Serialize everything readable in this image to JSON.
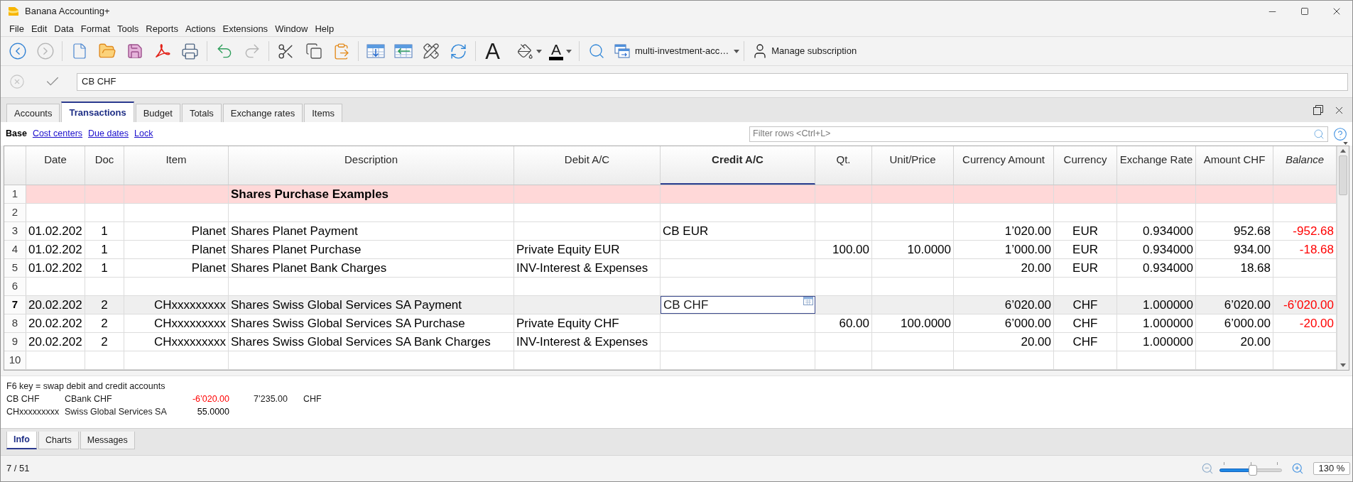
{
  "window": {
    "title": "Banana Accounting+"
  },
  "menu": [
    "File",
    "Edit",
    "Data",
    "Format",
    "Tools",
    "Reports",
    "Actions",
    "Extensions",
    "Window",
    "Help"
  ],
  "toolbar": {
    "back_disabled": false,
    "forward_disabled": true,
    "undo_disabled": false,
    "redo_disabled": true,
    "font_glyph": "A",
    "text_color_glyph": "A",
    "file_selector": "multi-investment-acc…",
    "subscription": "Manage subscription"
  },
  "formula_bar": {
    "value": "CB CHF"
  },
  "tabs": [
    {
      "label": "Accounts",
      "selected": false
    },
    {
      "label": "Transactions",
      "selected": true
    },
    {
      "label": "Budget",
      "selected": false
    },
    {
      "label": "Totals",
      "selected": false
    },
    {
      "label": "Exchange rates",
      "selected": false
    },
    {
      "label": "Items",
      "selected": false
    }
  ],
  "views": [
    {
      "label": "Base",
      "selected": true
    },
    {
      "label": "Cost centers",
      "selected": false
    },
    {
      "label": "Due dates",
      "selected": false
    },
    {
      "label": "Lock",
      "selected": false
    }
  ],
  "filter": {
    "placeholder": "Filter rows <Ctrl+L>"
  },
  "table": {
    "columns": [
      {
        "label": "Date",
        "selected": false,
        "protected": false
      },
      {
        "label": "Doc",
        "selected": false,
        "protected": false
      },
      {
        "label": "Item",
        "selected": false,
        "protected": false
      },
      {
        "label": "Description",
        "selected": false,
        "protected": false
      },
      {
        "label": "Debit A/C",
        "selected": false,
        "protected": false
      },
      {
        "label": "Credit A/C",
        "selected": true,
        "protected": false
      },
      {
        "label": "Qt.",
        "selected": false,
        "protected": false
      },
      {
        "label": "Unit/Price",
        "selected": false,
        "protected": false
      },
      {
        "label": "Currency Amount",
        "selected": false,
        "protected": false
      },
      {
        "label": "Currency",
        "selected": false,
        "protected": false
      },
      {
        "label": "Exchange Rate",
        "selected": false,
        "protected": false
      },
      {
        "label": "Amount CHF",
        "selected": false,
        "protected": false
      },
      {
        "label": "Balance",
        "selected": false,
        "protected": true
      }
    ],
    "rows": [
      {
        "number": "1",
        "kind": "title",
        "selected": false,
        "description": "Shares Purchase Examples"
      },
      {
        "number": "2",
        "kind": "entry",
        "selected": false
      },
      {
        "number": "3",
        "kind": "entry",
        "selected": false,
        "date": "01.02.202",
        "doc": "1",
        "item": "Planet",
        "description": "Shares Planet Payment",
        "credit_ac": "CB EUR",
        "currency_amount": "1’020.00",
        "currency": "EUR",
        "exchange_rate": "0.934000",
        "amount_chf": "952.68",
        "balance": "-952.68",
        "balance_negative": true
      },
      {
        "number": "4",
        "kind": "entry",
        "selected": false,
        "date": "01.02.202",
        "doc": "1",
        "item": "Planet",
        "description": "Shares Planet Purchase",
        "debit_ac": "Private Equity EUR",
        "qt": "100.00",
        "unit_price": "10.0000",
        "currency_amount": "1’000.00",
        "currency": "EUR",
        "exchange_rate": "0.934000",
        "amount_chf": "934.00",
        "balance": "-18.68",
        "balance_negative": true
      },
      {
        "number": "5",
        "kind": "entry",
        "selected": false,
        "date": "01.02.202",
        "doc": "1",
        "item": "Planet",
        "description": "Shares Planet Bank Charges",
        "debit_ac": "INV-Interest & Expenses",
        "currency_amount": "20.00",
        "currency": "EUR",
        "exchange_rate": "0.934000",
        "amount_chf": "18.68"
      },
      {
        "number": "6",
        "kind": "entry",
        "selected": false
      },
      {
        "number": "7",
        "kind": "entry",
        "selected": true,
        "date": "20.02.202",
        "doc": "2",
        "item": "CHxxxxxxxxx",
        "description": "Shares Swiss Global Services SA Payment",
        "credit_ac": "CB CHF",
        "currency_amount": "6’020.00",
        "currency": "CHF",
        "exchange_rate": "1.000000",
        "amount_chf": "6’020.00",
        "balance": "-6’020.00",
        "balance_negative": true
      },
      {
        "number": "8",
        "kind": "entry",
        "selected": false,
        "date": "20.02.202",
        "doc": "2",
        "item": "CHxxxxxxxxx",
        "description": "Shares Swiss Global Services SA Purchase",
        "debit_ac": "Private Equity CHF",
        "qt": "60.00",
        "unit_price": "100.0000",
        "currency_amount": "6’000.00",
        "currency": "CHF",
        "exchange_rate": "1.000000",
        "amount_chf": "6’000.00",
        "balance": "-20.00",
        "balance_negative": true
      },
      {
        "number": "9",
        "kind": "entry",
        "selected": false,
        "date": "20.02.202",
        "doc": "2",
        "item": "CHxxxxxxxxx",
        "description": "Shares Swiss Global Services SA Bank Charges",
        "debit_ac": "INV-Interest & Expenses",
        "currency_amount": "20.00",
        "currency": "CHF",
        "exchange_rate": "1.000000",
        "amount_chf": "20.00"
      },
      {
        "number": "10",
        "kind": "entry",
        "selected": false
      }
    ]
  },
  "info_panel": {
    "hint": "F6 key = swap debit and credit accounts",
    "lines": [
      {
        "code": "CB CHF",
        "name": "CBank CHF",
        "amount": "-6’020.00",
        "amount_negative": true,
        "balance": "7’235.00",
        "currency": "CHF"
      },
      {
        "code": "CHxxxxxxxxx",
        "name": "Swiss Global Services SA",
        "amount": "55.0000",
        "amount_negative": false
      }
    ]
  },
  "bottom_tabs": [
    {
      "label": "Info",
      "selected": true
    },
    {
      "label": "Charts",
      "selected": false
    },
    {
      "label": "Messages",
      "selected": false
    }
  ],
  "status_bar": {
    "position": "7 / 51",
    "zoom_slider": {
      "level": 0.53
    },
    "zoom_value": "130 %"
  }
}
